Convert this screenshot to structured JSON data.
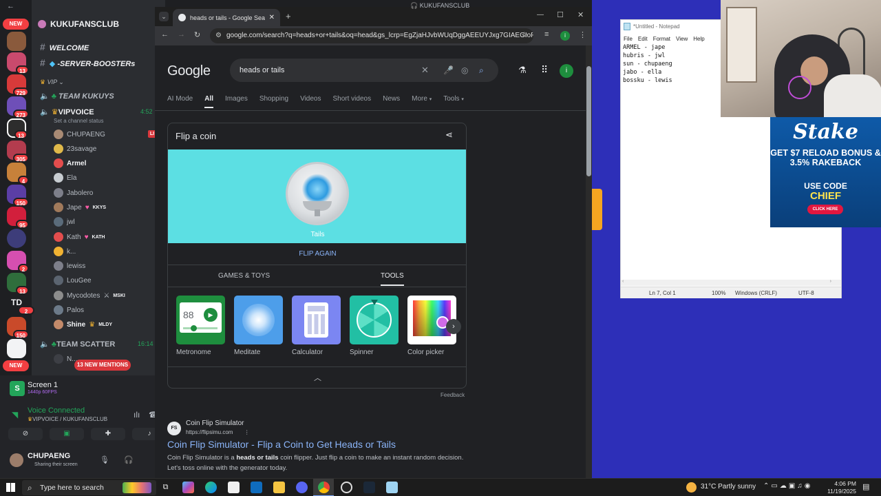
{
  "discord": {
    "server_name": "KUKUFANSCLUB",
    "new_pill_top": "NEW",
    "new_pill_bottom": "NEW",
    "guild_badges": [
      "13",
      "729",
      "273",
      "13",
      "305",
      "4",
      "150",
      "95",
      "2",
      "13",
      "2",
      "150"
    ],
    "guild_text_td": "TD",
    "channels": {
      "welcome": "WELCOME",
      "server_boosters": "-SERVER-BOOSTERs",
      "vip_category": "VIP",
      "team_kukuys": "TEAM KUKUYS",
      "vipvoice": "VIPVOICE",
      "vipvoice_time": "4:52",
      "channel_status": "Set a channel status",
      "team_scatter": "TEAM SCATTER",
      "team_scatter_time": "16:14"
    },
    "voice_members": [
      {
        "name": "CHUPAENG",
        "tag": ""
      },
      {
        "name": "23savage",
        "tag": ""
      },
      {
        "name": "Armel",
        "tag": ""
      },
      {
        "name": "Ela",
        "tag": ""
      },
      {
        "name": "Jabolero",
        "tag": ""
      },
      {
        "name": "Jape",
        "tag": "KKYS"
      },
      {
        "name": "jwl",
        "tag": ""
      },
      {
        "name": "Kath",
        "tag": "KATH"
      },
      {
        "name": "k...",
        "tag": ""
      },
      {
        "name": "lewiss",
        "tag": ""
      },
      {
        "name": "LouGee",
        "tag": ""
      },
      {
        "name": "Mycodotes",
        "tag": "MSKI"
      },
      {
        "name": "Palos",
        "tag": ""
      },
      {
        "name": "Shine",
        "tag": "MLDY"
      }
    ],
    "truncated_member": "N...",
    "new_mentions": "13 NEW MENTIONS",
    "live_badge": "LI",
    "screen_share": {
      "title": "Screen 1",
      "quality": "1440p 60FPS"
    },
    "voice_status": {
      "label": "Voice Connected",
      "location": "VIPVOICE / KUKUFANSCLUB"
    },
    "user": {
      "name": "CHUPAENG",
      "status": "Sharing their screen"
    }
  },
  "chrome": {
    "tab_title": "heads or tails - Google Search",
    "url": "google.com/search?q=heads+or+tails&oq=head&gs_lcrp=EgZjaHJvbWUqDggAEEUYJxg7GIAEGIoF...",
    "profile_initial": "i"
  },
  "google": {
    "logo": "Google",
    "query": "heads or tails",
    "tabs": [
      "AI Mode",
      "All",
      "Images",
      "Shopping",
      "Videos",
      "Short videos",
      "News",
      "More",
      "Tools"
    ],
    "active_tab": "All",
    "coin_widget": {
      "title": "Flip a coin",
      "result": "Tails",
      "flip_again": "FLIP AGAIN",
      "tab_games": "GAMES & TOYS",
      "tab_tools": "TOOLS",
      "tools": [
        {
          "label": "Metronome",
          "value": "88",
          "color": "#1e8e3e"
        },
        {
          "label": "Meditate",
          "color": "#4d9eea"
        },
        {
          "label": "Calculator",
          "color": "#7b86f2"
        },
        {
          "label": "Spinner",
          "color": "#22bfa4"
        },
        {
          "label": "Color picker",
          "color": "#ffffff"
        }
      ]
    },
    "feedback": "Feedback",
    "result": {
      "favicon": "FS",
      "site_name": "Coin Flip Simulator",
      "url": "https://flipsimu.com",
      "title": "Coin Flip Simulator - Flip a Coin to Get Heads or Tails",
      "snippet_before": "Coin Flip Simulator is a ",
      "snippet_bold": "heads or tails",
      "snippet_after": " coin flipper. Just flip a coin to make an instant random decision. Let's toss online with the generator today."
    }
  },
  "notepad": {
    "title": "*Untitled - Notepad",
    "menu": [
      "File",
      "Edit",
      "Format",
      "View",
      "Help"
    ],
    "content": "ARMEL - jape\nhubris - jwl\nsun - chupaeng\njabo - ella\nbossku - lewis",
    "status": {
      "position": "Ln 7, Col 1",
      "zoom": "100%",
      "line_ending": "Windows (CRLF)",
      "encoding": "UTF-8"
    }
  },
  "ad": {
    "brand": "Stake",
    "offer": "GET $7 RELOAD BONUS & 3.5% RAKEBACK",
    "code_label": "USE CODE",
    "code": "CHIEF",
    "button": "CLICK HERE"
  },
  "taskbar": {
    "search_placeholder": "Type here to search",
    "weather": "31°C  Partly sunny",
    "time": "4:06 PM",
    "date": "11/19/2025"
  },
  "colors": {
    "discord_bg": "#2b2d31",
    "chrome_bg": "#202124",
    "coin_area": "#5cdfe3",
    "link": "#8ab4f8",
    "desktop": "#2d2fb8",
    "discord_green": "#23a55a"
  }
}
